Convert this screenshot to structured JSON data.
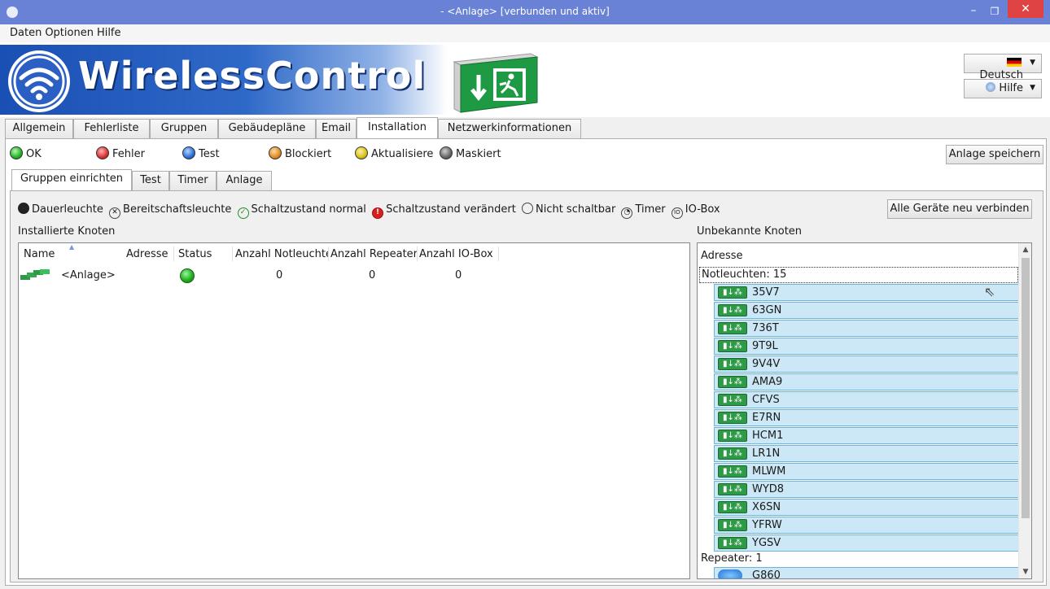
{
  "window": {
    "title": "- <Anlage> [verbunden und aktiv]",
    "minimize_glyph": "–",
    "maximize_glyph": "❐",
    "close_glyph": "✕"
  },
  "menu": [
    "Daten",
    "Optionen",
    "Hilfe"
  ],
  "header": {
    "brand": "WirelessControl",
    "language_label": "Deutsch",
    "help_label": "Hilfe"
  },
  "main_tabs": [
    "Allgemein",
    "Fehlerliste",
    "Gruppen",
    "Gebäudepläne",
    "Email",
    "Installation",
    "Netzwerkinformationen"
  ],
  "active_main_tab": "Installation",
  "status_legend": [
    {
      "label": "OK",
      "color": "#22b322"
    },
    {
      "label": "Fehler",
      "color": "#d93030"
    },
    {
      "label": "Test",
      "color": "#2a6fd6"
    },
    {
      "label": "Blockiert",
      "color": "#e08a1e"
    },
    {
      "label": "Aktualisiere",
      "color": "#d6c21a"
    },
    {
      "label": "Maskiert",
      "color": "#666666"
    }
  ],
  "save_button": "Anlage speichern",
  "sub_tabs": [
    "Gruppen einrichten",
    "Test",
    "Timer",
    "Anlage"
  ],
  "active_sub_tab": "Gruppen einrichten",
  "symbol_legend": [
    {
      "icon": "dauerleuchte-icon",
      "label": "Dauerleuchte"
    },
    {
      "icon": "bereitschaftsleuchte-icon",
      "label": "Bereitschaftsleuchte"
    },
    {
      "icon": "schaltzustand-normal-icon",
      "label": "Schaltzustand normal"
    },
    {
      "icon": "schaltzustand-veraendert-icon",
      "label": "Schaltzustand verändert"
    },
    {
      "icon": "nicht-schaltbar-icon",
      "label": "Nicht schaltbar"
    },
    {
      "icon": "timer-icon",
      "label": "Timer"
    },
    {
      "icon": "io-box-icon",
      "label": "IO-Box"
    }
  ],
  "reconnect_button": "Alle Geräte neu verbinden",
  "installed": {
    "label": "Installierte Knoten",
    "columns": [
      "Name",
      "Adresse",
      "Status",
      "Anzahl Notleuchten",
      "Anzahl Repeater",
      "Anzahl IO-Box"
    ],
    "rows": [
      {
        "name": "<Anlage>",
        "adresse": "",
        "status": "green",
        "notleuchten": "0",
        "repeater": "0",
        "iobox": "0"
      }
    ]
  },
  "unknown": {
    "label": "Unbekannte Knoten",
    "column": "Adresse",
    "groups": [
      {
        "title": "Notleuchten: 15",
        "items": [
          "35V7",
          "63GN",
          "736T",
          "9T9L",
          "9V4V",
          "AMA9",
          "CFVS",
          "E7RN",
          "HCM1",
          "LR1N",
          "MLWM",
          "WYD8",
          "X6SN",
          "YFRW",
          "YGSV"
        ]
      },
      {
        "title": "Repeater: 1",
        "items": [
          "G860"
        ]
      }
    ]
  }
}
